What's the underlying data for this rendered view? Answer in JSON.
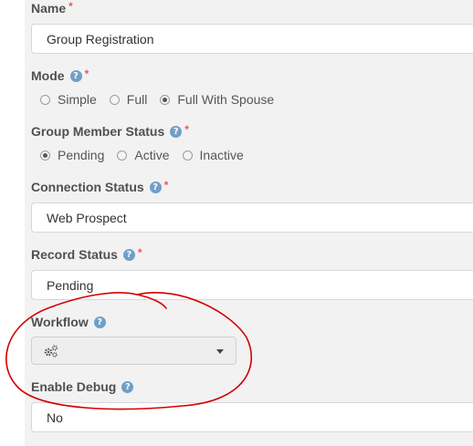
{
  "form": {
    "name": {
      "label": "Name",
      "value": "Group Registration"
    },
    "mode": {
      "label": "Mode",
      "options": [
        {
          "label": "Simple",
          "checked": false
        },
        {
          "label": "Full",
          "checked": false
        },
        {
          "label": "Full With Spouse",
          "checked": true
        }
      ]
    },
    "group_member_status": {
      "label": "Group Member Status",
      "options": [
        {
          "label": "Pending",
          "checked": true
        },
        {
          "label": "Active",
          "checked": false
        },
        {
          "label": "Inactive",
          "checked": false
        }
      ]
    },
    "connection_status": {
      "label": "Connection Status",
      "value": "Web Prospect"
    },
    "record_status": {
      "label": "Record Status",
      "value": "Pending"
    },
    "workflow": {
      "label": "Workflow",
      "value": ""
    },
    "enable_debug": {
      "label": "Enable Debug",
      "value": "No"
    },
    "required_marker": "*",
    "help_glyph": "?"
  },
  "colors": {
    "required": "#e55a5a",
    "help": "#6f9fc8",
    "annotation": "#d40000"
  },
  "icons": {
    "help": "question-circle-icon",
    "workflow": "gears-icon",
    "dropdown": "caret-down-icon"
  }
}
